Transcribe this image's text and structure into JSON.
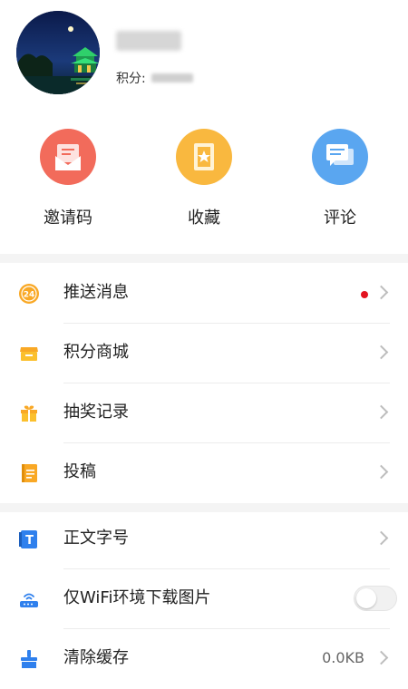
{
  "profile": {
    "points_label": "积分:"
  },
  "quick_actions": [
    {
      "label": "邀请码",
      "icon": "envelope-icon",
      "color": "#f26b5b"
    },
    {
      "label": "收藏",
      "icon": "bookmark-icon",
      "color": "#f9b83f"
    },
    {
      "label": "评论",
      "icon": "comment-icon",
      "color": "#5aa6f0"
    }
  ],
  "menu_group1": [
    {
      "label": "推送消息",
      "icon": "badge-24-icon",
      "has_red_dot": true
    },
    {
      "label": "积分商城",
      "icon": "store-icon"
    },
    {
      "label": "抽奖记录",
      "icon": "gift-icon"
    },
    {
      "label": "投稿",
      "icon": "document-icon"
    }
  ],
  "menu_group2": [
    {
      "label": "正文字号",
      "icon": "font-size-icon"
    },
    {
      "label": "仅WiFi环境下载图片",
      "icon": "router-icon",
      "toggle_on": false
    },
    {
      "label": "清除缓存",
      "icon": "broom-icon",
      "value": "0.0KB"
    }
  ],
  "badge_text": "24",
  "font_icon_text": "T",
  "colors": {
    "accent_red": "#e3131f",
    "icon_orange": "#f9a825",
    "icon_blue": "#2f80ed"
  }
}
